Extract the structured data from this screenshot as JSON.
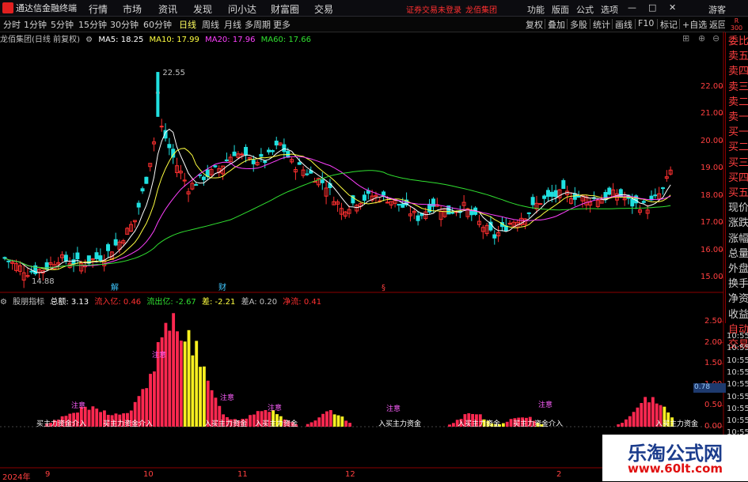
{
  "app": {
    "title": "通达信金融终端",
    "window_buttons": [
      "—",
      "□",
      "✕"
    ]
  },
  "menu": [
    "行情",
    "市场",
    "资讯",
    "发现",
    "问小达",
    "财富圈",
    "交易"
  ],
  "status_text": "证券交易未登录",
  "stock_name_top": "龙佰集团",
  "right_menu": [
    "功能",
    "版面",
    "公式",
    "选项"
  ],
  "guest_label": "游客",
  "toolbar": {
    "periods": [
      "分时",
      "1分钟",
      "5分钟",
      "15分钟",
      "30分钟",
      "60分钟",
      "日线",
      "周线",
      "月线",
      "多周期",
      "更多"
    ],
    "active_period": "日线",
    "right_buttons": [
      "复权",
      "叠加",
      "多股",
      "统计",
      "画线",
      "F10",
      "标记",
      "+自选",
      "返回"
    ]
  },
  "main_legend": {
    "title": "龙佰集团(日线 前复权)",
    "ma5": "MA5: 18.25",
    "ma10": "MA10: 17.99",
    "ma20": "MA20: 17.96",
    "ma60": "MA60: 17.66"
  },
  "sub_legend": {
    "title": "股朋指标",
    "total": "总额: 3.13",
    "inflow": "流入亿: 0.46",
    "outflow": "流出亿: -2.67",
    "diff": "差: -2.21",
    "diffA": "差A: 0.20",
    "net": "净流: 0.41"
  },
  "price_axis": [
    "22.00",
    "21.00",
    "20.00",
    "19.00",
    "18.00",
    "17.00",
    "16.00",
    "15.00"
  ],
  "sub_axis": [
    "2.50",
    "2.00",
    "1.50",
    "1.00",
    "0.50",
    "0.00"
  ],
  "max_label": "22.55",
  "min_label": "14.88",
  "markers": [
    "解",
    "财",
    "§"
  ],
  "right_panel": [
    "委比",
    "卖五",
    "卖四",
    "卖三",
    "卖二",
    "卖一",
    "买一",
    "买二",
    "买三",
    "买四",
    "买五",
    "现价",
    "涨跌",
    "涨幅",
    "总量",
    "外盘",
    "换手",
    "净资",
    "收益",
    "自动",
    "交易"
  ],
  "r_top": "R\n300",
  "trade_times": [
    "10:55",
    "10:55",
    "10:55",
    "10:55",
    "10:55",
    "10:55",
    "10:55",
    "10:55",
    "10:55",
    "10:55",
    "10:55"
  ],
  "trade_highlight": "0.78",
  "date_axis": [
    "2024年",
    "9",
    "10",
    "11",
    "12",
    "2"
  ],
  "annotations": [
    "注意",
    "入买主力资金",
    "买主力资金介入"
  ],
  "ad": {
    "line1": "乐淘公式网",
    "line2": "www.60lt.com"
  },
  "colors": {
    "up": "#ff3030",
    "down": "#20e0e0",
    "ma5": "#ffffff",
    "ma10": "#ffff40",
    "ma20": "#ff40ff",
    "ma60": "#30e030",
    "bar_red": "#ff2850",
    "bar_yellow": "#f8f020",
    "bar_cyan": "#40c8ff"
  }
}
